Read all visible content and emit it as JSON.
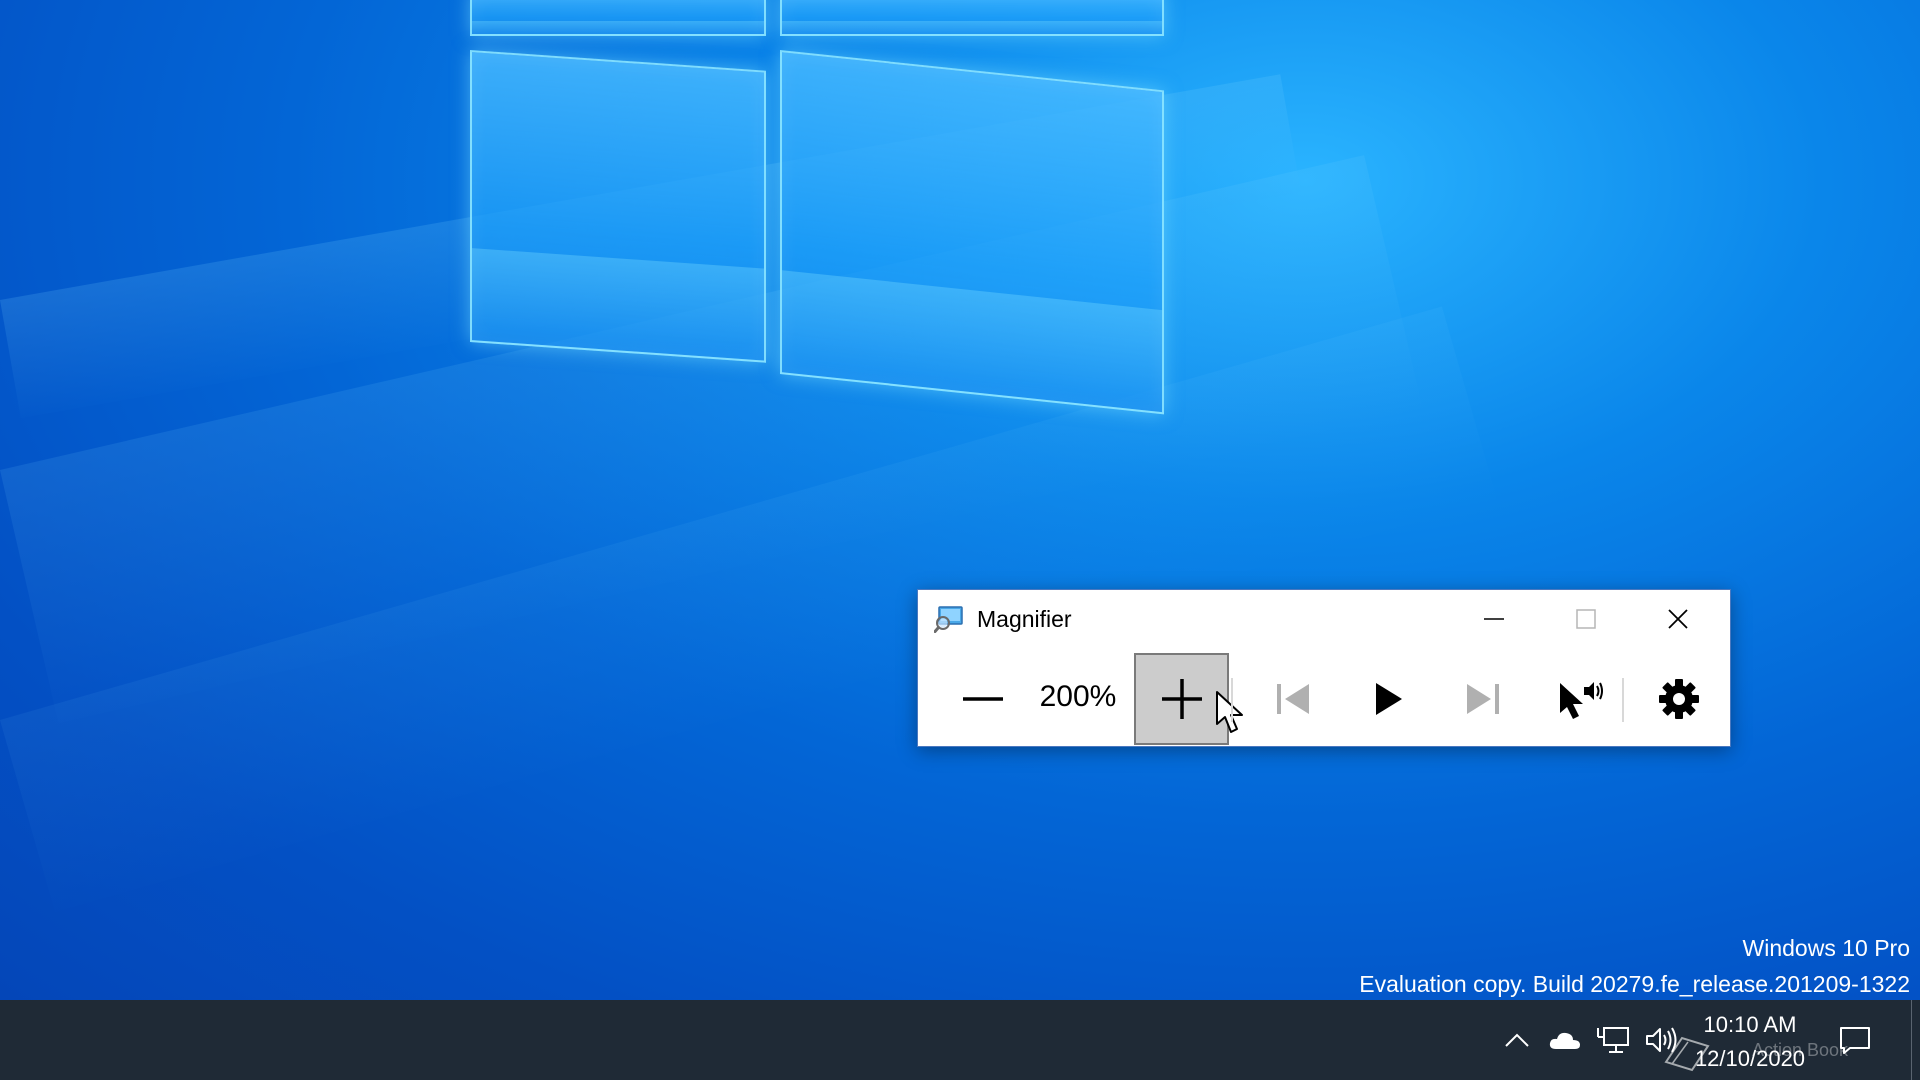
{
  "desktop": {
    "watermark_line1": "Windows 10 Pro",
    "watermark_line2": "Evaluation copy. Build 20279.fe_release.201209-1322"
  },
  "magnifier": {
    "title": "Magnifier",
    "zoom_level": "200%",
    "buttons": {
      "minimize": "minimize-icon",
      "maximize": "maximize-icon",
      "close": "close-icon",
      "zoom_out": "minus-icon",
      "zoom_in": "plus-icon",
      "read_previous": "skip-back-icon",
      "play": "play-icon",
      "read_next": "skip-forward-icon",
      "read_from_here": "cursor-speaker-icon",
      "settings": "gear-icon"
    }
  },
  "taskbar": {
    "time": "10:10 AM",
    "date": "12/10/2020",
    "watermark": "Action Book",
    "tray_icons": [
      "chevron-up-icon",
      "onedrive-cloud-icon",
      "network-icon",
      "volume-icon",
      "notification-icon"
    ]
  },
  "colors": {
    "taskbar_bg": "#1f2a36",
    "zoom_in_pressed_bg": "#cccccc",
    "window_border": "#4a78c0"
  }
}
